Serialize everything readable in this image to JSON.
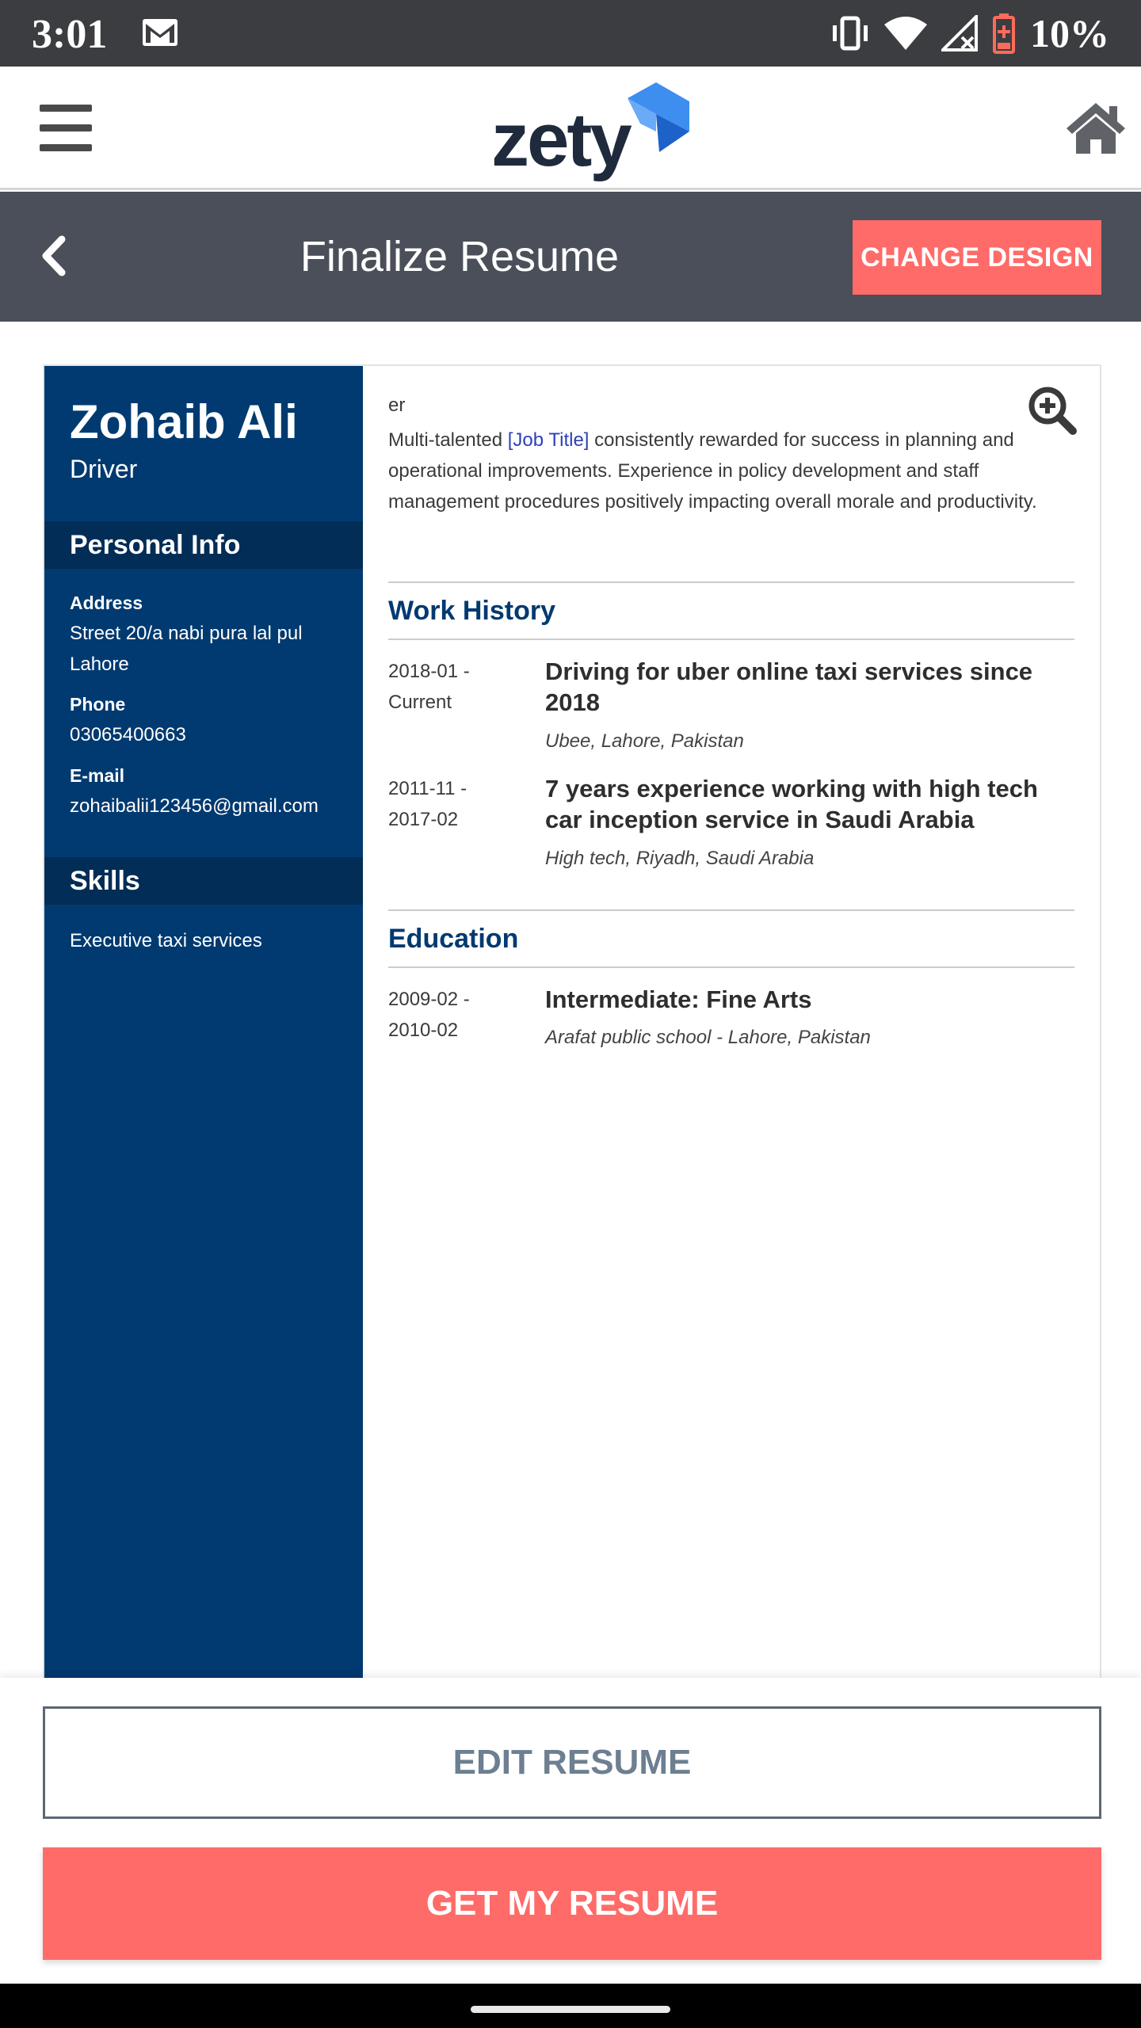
{
  "status_bar": {
    "time": "3:01",
    "battery": "10%"
  },
  "header": {
    "logo_text": "zety"
  },
  "toolbar": {
    "title": "Finalize Resume",
    "change_design_label": "CHANGE DESIGN"
  },
  "resume": {
    "name": "Zohaib Ali",
    "role": "Driver",
    "personal_info_title": "Personal Info",
    "address_label": "Address",
    "address_value": "Street 20/a nabi pura lal pul Lahore",
    "phone_label": "Phone",
    "phone_value": "03065400663",
    "email_label": "E-mail",
    "email_value": "zohaibalii123456@gmail.com",
    "skills_title": "Skills",
    "skills": [
      "Executive taxi services"
    ],
    "summary_head": "er",
    "summary_prefix": "Multi-talented ",
    "summary_placeholder": "[Job Title]",
    "summary_suffix": " consistently rewarded for success in planning and operational improvements. Experience in policy development and staff management procedures positively impacting overall morale and productivity.",
    "work_history_title": "Work History",
    "work": [
      {
        "date": "2018-01 - Current",
        "title": "Driving for uber online taxi services since 2018",
        "subtitle": "Ubee, Lahore, Pakistan"
      },
      {
        "date": "2011-11 - 2017-02",
        "title": "7 years experience working with high tech car inception service in Saudi Arabia",
        "subtitle": "High tech, Riyadh, Saudi Arabia"
      }
    ],
    "education_title": "Education",
    "education": [
      {
        "date": "2009-02 - 2010-02",
        "title": "Intermediate: Fine Arts",
        "subtitle": "Arafat public school - Lahore, Pakistan"
      }
    ]
  },
  "actions": {
    "edit_label": "EDIT RESUME",
    "get_label": "GET MY RESUME"
  },
  "colors": {
    "accent": "#ff6b68",
    "sidebar": "#003a70",
    "toolbar": "#4a4f59",
    "status_bar": "#3c3d41"
  },
  "icons": [
    "mail-icon",
    "vibrate-icon",
    "wifi-icon",
    "signal-icon",
    "battery-icon",
    "menu-icon",
    "home-icon",
    "back-icon",
    "zoom-in-icon"
  ]
}
